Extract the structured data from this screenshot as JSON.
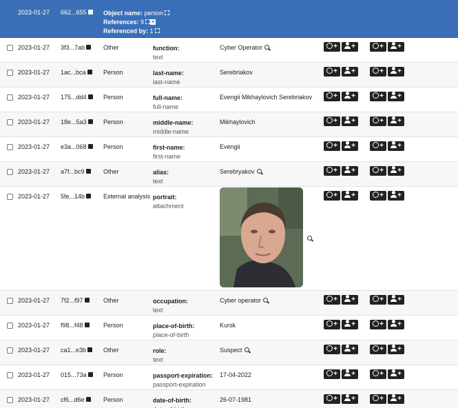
{
  "header": {
    "date": "2023-01-27",
    "uuid": "662...655",
    "object_name_label": "Object name:",
    "object_name": "person",
    "references_label": "References:",
    "references": "9",
    "referenced_by_label": "Referenced by:",
    "referenced_by": "1"
  },
  "rows": [
    {
      "date": "2023-01-27",
      "uuid": "3f3...7ab",
      "category": "Other",
      "relation": "function:",
      "type": "text",
      "value": "Cyber Operator",
      "zoom": true
    },
    {
      "date": "2023-01-27",
      "uuid": "1ac...bca",
      "category": "Person",
      "relation": "last-name:",
      "type": "last-name",
      "value": "Serebriakov",
      "zoom": false
    },
    {
      "date": "2023-01-27",
      "uuid": "175...dd4",
      "category": "Person",
      "relation": "full-name:",
      "type": "full-name",
      "value": "Evengii Mikhaylovich Serebriakov",
      "zoom": false
    },
    {
      "date": "2023-01-27",
      "uuid": "18e...5a3",
      "category": "Person",
      "relation": "middle-name:",
      "type": "middle-name",
      "value": "Mikhaylovich",
      "zoom": false
    },
    {
      "date": "2023-01-27",
      "uuid": "e3a...068",
      "category": "Person",
      "relation": "first-name:",
      "type": "first-name",
      "value": "Evengii",
      "zoom": false
    },
    {
      "date": "2023-01-27",
      "uuid": "a7f...bc9",
      "category": "Other",
      "relation": "alias:",
      "type": "text",
      "value": "Serebryakov",
      "zoom": true
    },
    {
      "date": "2023-01-27",
      "uuid": "5fe...14b",
      "category": "External analysis",
      "relation": "portrait:",
      "type": "attachment",
      "value": "",
      "zoom": true
    },
    {
      "date": "2023-01-27",
      "uuid": "7f2...f97",
      "category": "Other",
      "relation": "occupation:",
      "type": "text",
      "value": "Cyber operator",
      "zoom": true
    },
    {
      "date": "2023-01-27",
      "uuid": "f98...f48",
      "category": "Person",
      "relation": "place-of-birth:",
      "type": "place-of-birth",
      "value": "Kursk",
      "zoom": false
    },
    {
      "date": "2023-01-27",
      "uuid": "ca1...e3b",
      "category": "Other",
      "relation": "role:",
      "type": "text",
      "value": "Suspect",
      "zoom": true
    },
    {
      "date": "2023-01-27",
      "uuid": "015...73a",
      "category": "Person",
      "relation": "passport-expiration:",
      "type": "passport-expiration",
      "value": "17-04-2022",
      "zoom": false
    },
    {
      "date": "2023-01-27",
      "uuid": "cf6...d6e",
      "category": "Person",
      "relation": "date-of-birth:",
      "type": "date-of-birth",
      "value": "26-07-1981",
      "zoom": false
    }
  ],
  "actions": {
    "plus": "+",
    "icons": [
      "globe-icon",
      "add-person-icon"
    ]
  },
  "colors": {
    "header_bg": "#3a6fb8",
    "alt_row_bg": "#f7f7f7",
    "button_bg": "#222222"
  }
}
